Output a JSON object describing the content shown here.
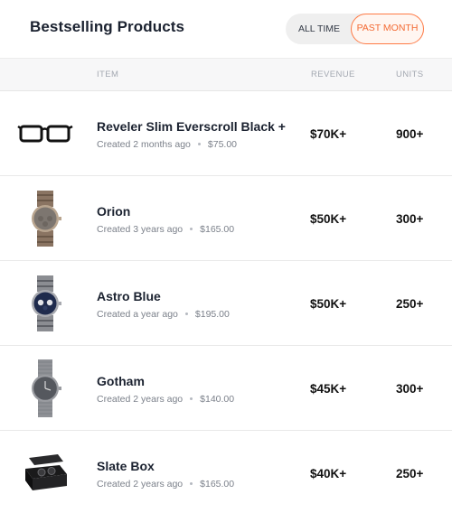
{
  "header": {
    "title": "Bestselling Products",
    "toggle": {
      "all_time": "ALL TIME",
      "past_month": "PAST MONTH",
      "selected": "PAST MONTH"
    },
    "accent_color": "#ff7a45"
  },
  "table": {
    "columns": {
      "item": "ITEM",
      "revenue": "REVENUE",
      "units": "UNITS"
    },
    "rows": [
      {
        "name": "Reveler Slim Everscroll Black +",
        "created": "Created 2 months ago",
        "price": "$75.00",
        "revenue": "$70K+",
        "units": "900+",
        "image": "glasses-icon"
      },
      {
        "name": "Orion",
        "created": "Created 3 years ago",
        "price": "$165.00",
        "revenue": "$50K+",
        "units": "300+",
        "image": "watch-icon"
      },
      {
        "name": "Astro Blue",
        "created": "Created a year ago",
        "price": "$195.00",
        "revenue": "$50K+",
        "units": "250+",
        "image": "watch-icon"
      },
      {
        "name": "Gotham",
        "created": "Created 2 years ago",
        "price": "$140.00",
        "revenue": "$45K+",
        "units": "300+",
        "image": "watch-icon"
      },
      {
        "name": "Slate Box",
        "created": "Created 2 years ago",
        "price": "$165.00",
        "revenue": "$40K+",
        "units": "250+",
        "image": "watch-box-icon"
      }
    ]
  }
}
